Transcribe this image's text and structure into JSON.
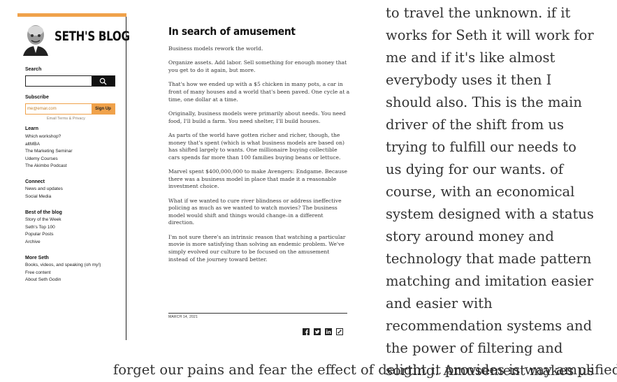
{
  "sidebar": {
    "blog_title": "SETH'S BLOG",
    "search_label": "Search",
    "search_placeholder": "",
    "subscribe_label": "Subscribe",
    "email_placeholder": "me@email.com",
    "signup_label": "Sign Up",
    "email_terms": "Email Terms & Privacy",
    "sections": [
      {
        "heading": "Learn",
        "items": [
          "Which workshop?",
          "altMBA",
          "The Marketing Seminar",
          "Udemy Courses",
          "The Akimbo Podcast"
        ]
      },
      {
        "heading": "Connect",
        "items": [
          "News and updates",
          "Social Media"
        ]
      },
      {
        "heading": "Best of the blog",
        "items": [
          "Story of the Week",
          "Seth's Top 100",
          "Popular Posts",
          "Archive"
        ]
      },
      {
        "heading": "More Seth",
        "items": [
          "Books, videos, and speaking (oh my!)",
          "Free content",
          "About Seth Godin"
        ]
      }
    ]
  },
  "post": {
    "title": "In search of amusement",
    "paragraphs": [
      "Business models rework the world.",
      "Organize assets. Add labor. Sell something for enough money that you get to do it again, but more.",
      "That's how we ended up with a $5 chicken in many pots, a car in front of many houses and a world that's been paved. One cycle at a time, one dollar at a time.",
      "Originally, business models were primarily about needs. You need food, I'll build a farm. You need shelter, I'll build houses.",
      "As parts of the world have gotten richer and richer, though, the money that's spent (which is what business models are based on) has shifted largely to wants. One millionaire buying collectible cars spends far more than 100 families buying beans or lettuce.",
      "Marvel spent $400,000,000 to make Avengers: Endgame. Because there was a business model in place that made it a reasonable investment choice.",
      "What if we wanted to cure river blindness or address ineffective policing as much as we wanted to watch movies? The business model would shift and things would change–in a different direction.",
      "I'm not sure there's an intrinsic reason that watching a particular movie is more satisfying than solving an endemic problem. We've simply evolved our culture to be focused on the amusement instead of the journey toward better."
    ],
    "date": "MARCH 14, 2021",
    "share_icons": [
      "facebook-icon",
      "twitter-icon",
      "linkedin-icon",
      "link-icon"
    ]
  },
  "comment": {
    "text": "to travel the unknown. if it works for Seth it will work for me and if it's like almost everybody uses it then I should also. This is the main driver of the shift from us trying to fulfill our needs to us dying for our wants. of course, with an economical system designed with a status story around money and technology that made pattern matching and imitation easier and easier with recommendation systems and the power of filtering and sorting. Amusement makes us",
    "bottom_line": "forget our pains and fear the effect of delight it provides is way amplified"
  },
  "colors": {
    "accent": "#f0a24b",
    "text": "#222222"
  }
}
